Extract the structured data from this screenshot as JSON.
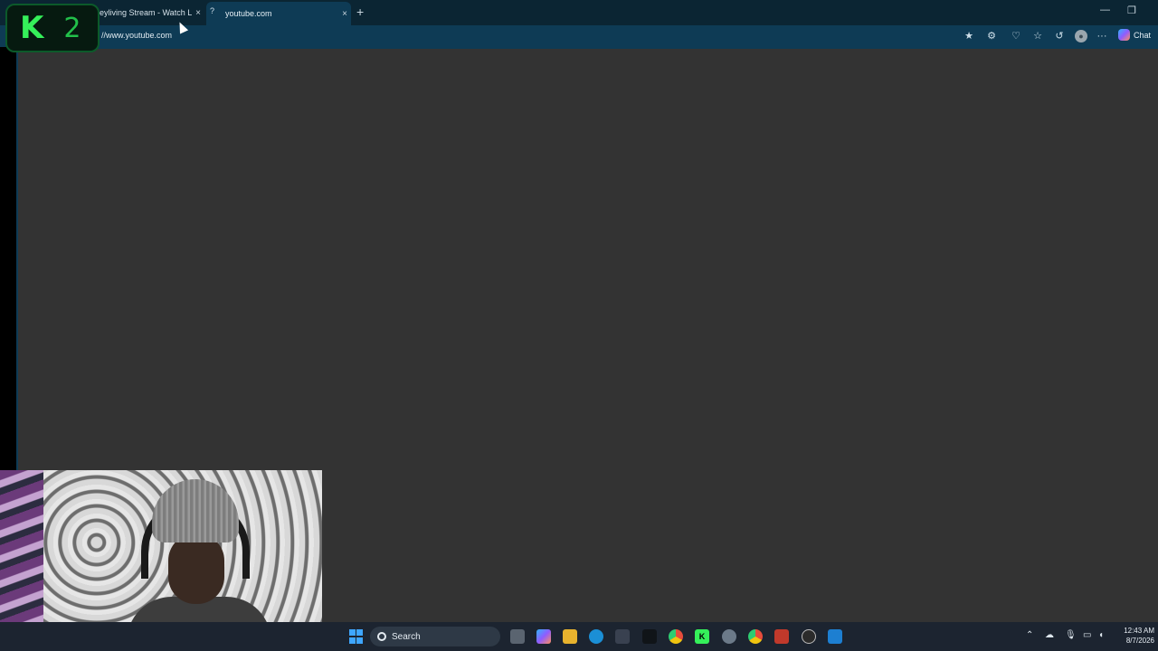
{
  "browser": {
    "tabs": [
      {
        "title": "eyliving Stream - Watch Live",
        "close": "×"
      },
      {
        "title": "youtube.com",
        "close": "×",
        "favicon": "?"
      }
    ],
    "new_tab": "+",
    "window_controls": {
      "minimize": "—",
      "maximize": "❐",
      "close": "✕"
    },
    "address": "//www.youtube.com",
    "toolbar_icons": [
      "star-icon",
      "extensions-icon",
      "browser-essentials-icon",
      "favorites-icon",
      "history-icon",
      "profile-icon",
      "more-icon"
    ],
    "more_glyph": "···",
    "chat_label": "Chat"
  },
  "overlay": {
    "logo_k": "K",
    "logo_number": "2"
  },
  "taskbar": {
    "search_label": "Search",
    "clock_time": "12:43 AM",
    "clock_date": "8/7/2026",
    "apps": [
      "task-view",
      "copilot",
      "file-explorer",
      "edge",
      "store",
      "terminal",
      "chrome",
      "kick",
      "settings",
      "chrome-2",
      "news",
      "obs",
      "photos"
    ]
  },
  "colors": {
    "tabstrip": "#0b2533",
    "toolbar": "#0e3b55",
    "content": "#333333",
    "logo_green": "#35f05a",
    "taskbar": "#1c2430"
  }
}
